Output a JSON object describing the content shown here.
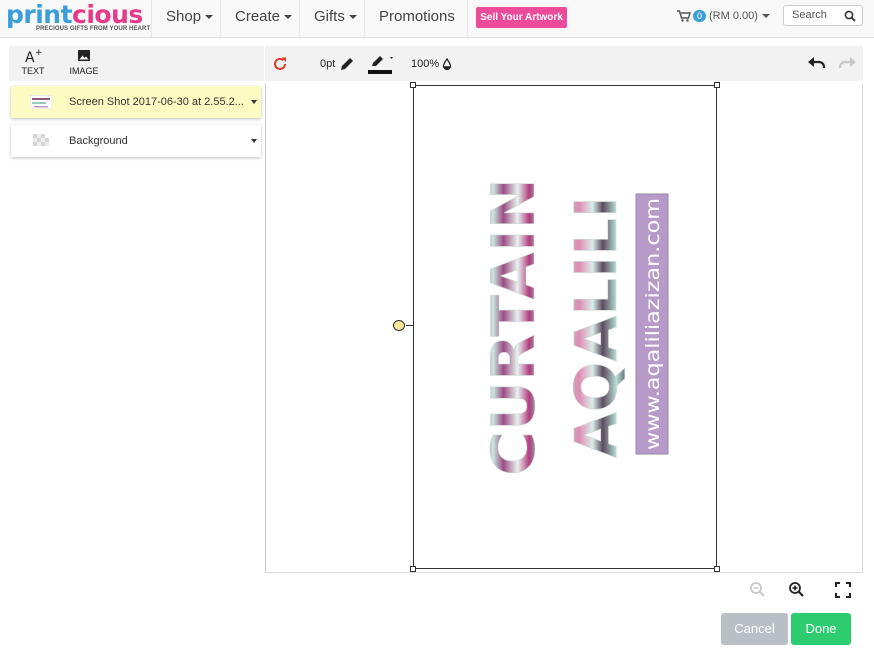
{
  "brand": {
    "name_part1": "print",
    "name_part2": "cious",
    "tagline": "PRECIOUS GIFTS FROM YOUR HEART",
    "primary_color": "#3a9fd8",
    "accent_color": "#e8388a"
  },
  "nav": {
    "items": [
      {
        "label": "Shop",
        "has_dropdown": true
      },
      {
        "label": "Create",
        "has_dropdown": true
      },
      {
        "label": "Gifts",
        "has_dropdown": true
      },
      {
        "label": "Promotions",
        "has_dropdown": false
      }
    ],
    "sell_button": "Sell Your Artwork",
    "cart": {
      "count": "0",
      "total": "(RM 0.00)"
    },
    "search_label": "Search"
  },
  "tools": {
    "text_label": "TEXT",
    "image_label": "IMAGE"
  },
  "layers": [
    {
      "label": "Screen Shot 2017-06-30 at 2.55.2...",
      "selected": true
    },
    {
      "label": "Background",
      "selected": false
    }
  ],
  "toolbar": {
    "stroke_width": "0pt",
    "opacity": "100%"
  },
  "artwork": {
    "line1": "CURTAIN",
    "line2": "AQALILI",
    "website": "www.aqaliliazizan.com",
    "website_bg": "#b79ac8"
  },
  "footer": {
    "cancel_label": "Cancel",
    "done_label": "Done",
    "cancel_color": "#b9bfc4",
    "done_color": "#2ecc71"
  }
}
